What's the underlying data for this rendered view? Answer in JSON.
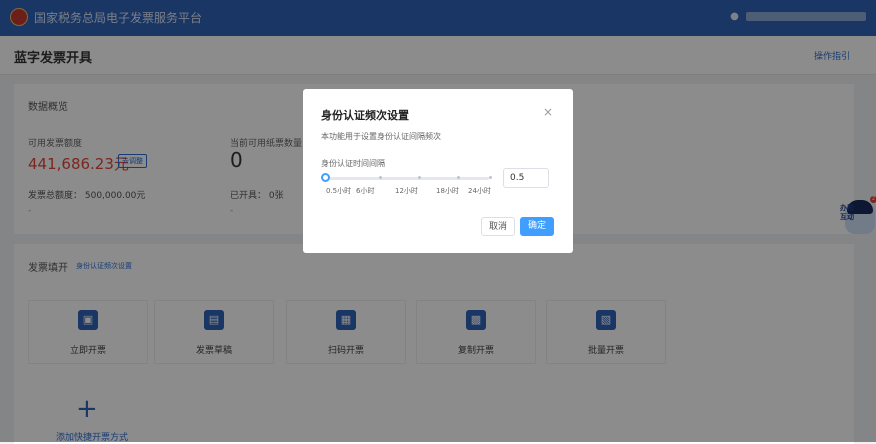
{
  "topbar": {
    "title": "国家税务总局电子发票服务平台",
    "user_icon": "user-icon"
  },
  "header": {
    "page_title": "蓝字发票开具",
    "help_link": "操作指引"
  },
  "summary": {
    "section_title": "数据概览",
    "available_amount_label": "可用发票额度",
    "available_amount_value": "441,686.23元",
    "adjust_label": "去调整",
    "available_count_label": "当前可用纸票数量：",
    "available_count_value": "0",
    "total_quota": "发票总额度： 500,000.00元",
    "issued": "已开具： 0张",
    "dash1": "-",
    "dash2": "-"
  },
  "issuance": {
    "section_title": "发票填开",
    "auth_settings_link": "身份认证频次设置",
    "tiles": [
      {
        "label": "立即开票",
        "icon": "invoice-icon"
      },
      {
        "label": "发票草稿",
        "icon": "draft-icon"
      },
      {
        "label": "扫码开票",
        "icon": "qr-icon"
      },
      {
        "label": "复制开票",
        "icon": "copy-icon"
      },
      {
        "label": "批量开票",
        "icon": "batch-icon"
      }
    ],
    "add_label": "添加快捷开票方式"
  },
  "dialog": {
    "title": "身份认证频次设置",
    "close": "×",
    "description": "本功能用于设置身份认证间隔频次",
    "field_label": "身份认证时间间隔",
    "slider_value": 0.5,
    "marks": [
      "0.5小时",
      "6小时",
      "12小时",
      "18小时",
      "24小时"
    ],
    "input_value": "0.5",
    "cancel_label": "取消",
    "ok_label": "确定",
    "accent_color": "#409eff"
  },
  "float_widget": {
    "text": "办税互动",
    "badge": "2"
  }
}
